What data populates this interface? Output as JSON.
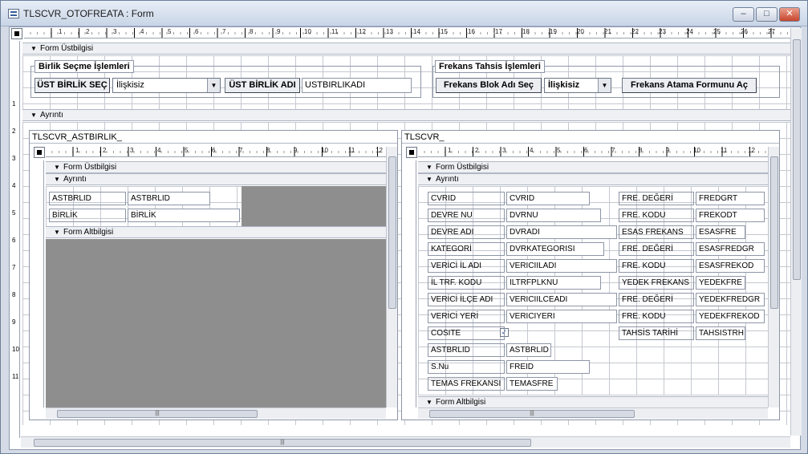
{
  "window": {
    "title": "TLSCVR_OTOFREATA : Form",
    "minimize": "–",
    "maximize": "□",
    "close": "✕"
  },
  "sections": {
    "header": "Form Üstbilgisi",
    "detail": "Ayrıntı",
    "footer": "Form Altbilgisi"
  },
  "header_form": {
    "group_birlik": "Birlik Seçme İşlemleri",
    "ust_birlik_sec_label": "ÜST BİRLİK SEÇ",
    "ust_birlik_combo_value": "İlişkisiz",
    "ust_birlik_adi_label": "ÜST BİRLİK ADI",
    "ust_birlik_adi_value": "USTBIRLIKADI",
    "group_frekans": "Frekans Tahsis İşlemleri",
    "frekans_blok_label": "Frekans Blok Adı Seç",
    "frekans_combo_value": "İlişkisiz",
    "frekans_atama_button": "Frekans Atama Formunu Aç"
  },
  "subform_left": {
    "title": "TLSCVR_ASTBIRLIK_",
    "fields": [
      {
        "label": "ASTBRLID",
        "value": "ASTBRLID"
      },
      {
        "label": "BİRLİK",
        "value": "BİRLİK"
      }
    ]
  },
  "subform_right": {
    "title": "TLSCVR_",
    "left_fields": [
      {
        "label": "CVRID",
        "value": "CVRID"
      },
      {
        "label": "DEVRE NU",
        "value": "DVRNU"
      },
      {
        "label": "DEVRE ADI",
        "value": "DVRADI"
      },
      {
        "label": "KATEGORİ",
        "value": "DVRKATEGORISI"
      },
      {
        "label": "VERİCİ İL ADI",
        "value": "VERICIILADI"
      },
      {
        "label": "İL TRF. KODU",
        "value": "ILTRFPLKNU"
      },
      {
        "label": "VERİCİ İLÇE ADI",
        "value": "VERICIILCEADI"
      },
      {
        "label": "VERİCİ YERİ",
        "value": "VERICIYERI"
      },
      {
        "label": "COSITE",
        "value": ""
      },
      {
        "label": "ASTBRLID",
        "value": "ASTBRLID"
      },
      {
        "label": "S.Nu",
        "value": "FREID"
      },
      {
        "label": "TEMAS FREKANSI",
        "value": "TEMASFRE"
      }
    ],
    "right_fields": [
      {
        "label": "FRE. DEĞERİ",
        "value": "FREDGRT"
      },
      {
        "label": "FRE. KODU",
        "value": "FREKODT"
      },
      {
        "label": "ESAS FREKANS",
        "value": "ESASFRE"
      },
      {
        "label": "FRE. DEĞERİ",
        "value": "ESASFREDGR"
      },
      {
        "label": "FRE. KODU",
        "value": "ESASFREKOD"
      },
      {
        "label": "YEDEK FREKANS",
        "value": "YEDEKFRE"
      },
      {
        "label": "FRE. DEĞERİ",
        "value": "YEDEKFREDGR"
      },
      {
        "label": "FRE. KODU",
        "value": "YEDEKFREKOD"
      },
      {
        "label": "TAHSİS TARİHİ",
        "value": "TAHSISTRH"
      }
    ],
    "cosite_checked": "✓"
  },
  "scroll_grip": "|||"
}
